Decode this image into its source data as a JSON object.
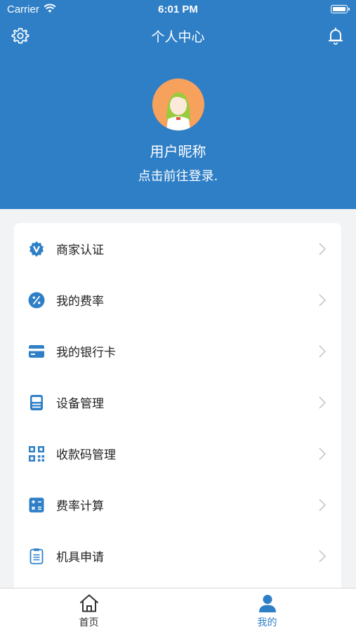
{
  "status_bar": {
    "carrier": "Carrier",
    "time": "6:01 PM"
  },
  "header": {
    "title": "个人中心",
    "nickname": "用户昵称",
    "login_hint": "点击前往登录."
  },
  "menu": {
    "items": [
      {
        "label": "商家认证",
        "icon": "verified-badge-icon"
      },
      {
        "label": "我的费率",
        "icon": "percent-icon"
      },
      {
        "label": "我的银行卡",
        "icon": "bank-card-icon"
      },
      {
        "label": "设备管理",
        "icon": "pos-device-icon"
      },
      {
        "label": "收款码管理",
        "icon": "qr-code-icon"
      },
      {
        "label": "费率计算",
        "icon": "calculator-icon"
      },
      {
        "label": "机具申请",
        "icon": "clipboard-icon"
      }
    ]
  },
  "tabbar": {
    "tabs": [
      {
        "label": "首页",
        "icon": "home-icon",
        "active": false
      },
      {
        "label": "我的",
        "icon": "user-icon",
        "active": true
      }
    ]
  },
  "colors": {
    "primary": "#2f7fc7",
    "active_tab": "#2f7fc7",
    "inactive_tab": "#333333"
  }
}
